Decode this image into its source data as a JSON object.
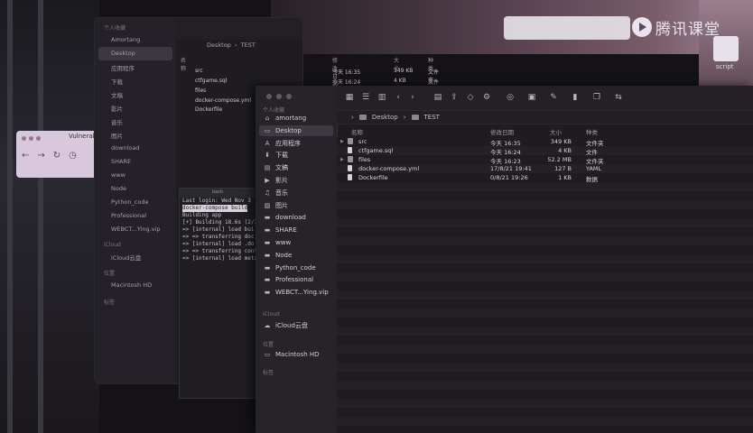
{
  "watermark": {
    "text": "腾讯课堂"
  },
  "desktop": {
    "script_label": "script"
  },
  "browser": {
    "tab_title": "Vulnerabi"
  },
  "finder_back": {
    "path": [
      "Desktop",
      "TEST"
    ],
    "sidebar": {
      "favorites_header": "个人收藏",
      "items": [
        "Amortang",
        "Desktop",
        "应用程序",
        "下载",
        "文稿",
        "影片",
        "音乐",
        "图片",
        "download",
        "SHARE",
        "www",
        "Node",
        "Python_code",
        "Professional",
        "WEBCT...Ying.vip"
      ],
      "icloud_header": "iCloud",
      "icloud_items": [
        "iCloud云盘"
      ],
      "locations_header": "位置",
      "locations_items": [
        "Macintosh HD"
      ],
      "tags_header": "标签"
    },
    "columns": {
      "name": "名称",
      "date": "修改日期",
      "size": "大小",
      "kind": "种类"
    },
    "rows": [
      {
        "name": "src",
        "date": "今天 16:35",
        "size": "349 KB",
        "kind": "文件夹"
      },
      {
        "name": "ctfgame.sql",
        "date": "今天 16:24",
        "size": "4 KB",
        "kind": "文件"
      },
      {
        "name": "files",
        "date": "",
        "size": "",
        "kind": ""
      },
      {
        "name": "docker-compose.yml",
        "date": "",
        "size": "",
        "kind": ""
      },
      {
        "name": "Dockerfile",
        "date": "",
        "size": "",
        "kind": ""
      }
    ]
  },
  "terminal": {
    "tab": "bash",
    "lines": [
      "Last login: Wed Nov  3",
      "Building app",
      "[+] Building 18.6s (2/3",
      "=> [internal] load bui",
      "=> => transferring doc",
      "=> [internal] load .do",
      "=> => transferring cont",
      "=> [internal] load meta"
    ],
    "highlight": "docker-compose build"
  },
  "finder_front": {
    "sidebar": {
      "favorites_header": "个人收藏",
      "items": [
        {
          "label": "amortang",
          "icon": "home-icon"
        },
        {
          "label": "Desktop",
          "icon": "desktop-icon",
          "selected": true
        },
        {
          "label": "应用程序",
          "icon": "apps-icon"
        },
        {
          "label": "下载",
          "icon": "download-icon"
        },
        {
          "label": "文稿",
          "icon": "document-icon"
        },
        {
          "label": "影片",
          "icon": "film-icon"
        },
        {
          "label": "音乐",
          "icon": "music-icon"
        },
        {
          "label": "图片",
          "icon": "photo-icon"
        },
        {
          "label": "download",
          "icon": "folder-icon"
        },
        {
          "label": "SHARE",
          "icon": "folder-icon"
        },
        {
          "label": "www",
          "icon": "folder-icon"
        },
        {
          "label": "Node",
          "icon": "folder-icon"
        },
        {
          "label": "Python_code",
          "icon": "folder-icon"
        },
        {
          "label": "Professional",
          "icon": "folder-icon"
        },
        {
          "label": "WEBCT...Ying.vip",
          "icon": "folder-icon"
        }
      ],
      "icloud_header": "iCloud",
      "icloud_items": [
        {
          "label": "iCloud云盘",
          "icon": "cloud-icon"
        }
      ],
      "locations_header": "位置",
      "locations_items": [
        {
          "label": "Macintosh HD",
          "icon": "disk-icon"
        }
      ],
      "tags_header": "标签"
    },
    "path": [
      "Desktop",
      "TEST"
    ],
    "columns": {
      "name": "名称",
      "date": "修改日期",
      "size": "大小",
      "kind": "种类"
    },
    "rows": [
      {
        "name": "src",
        "date": "今天 16:35",
        "size": "349 KB",
        "kind": "文件夹",
        "folder": true
      },
      {
        "name": "ctfgame.sql",
        "date": "今天 16:24",
        "size": "4 KB",
        "kind": "文件",
        "folder": false
      },
      {
        "name": "files",
        "date": "今天 16:23",
        "size": "52.2 MB",
        "kind": "文件夹",
        "folder": true
      },
      {
        "name": "docker-compose.yml",
        "date": "17/8/21 19:41",
        "size": "127 B",
        "kind": "YAML",
        "folder": false
      },
      {
        "name": "Dockerfile",
        "date": "0/8/21 19:26",
        "size": "1 KB",
        "kind": "数据",
        "folder": false
      }
    ]
  }
}
